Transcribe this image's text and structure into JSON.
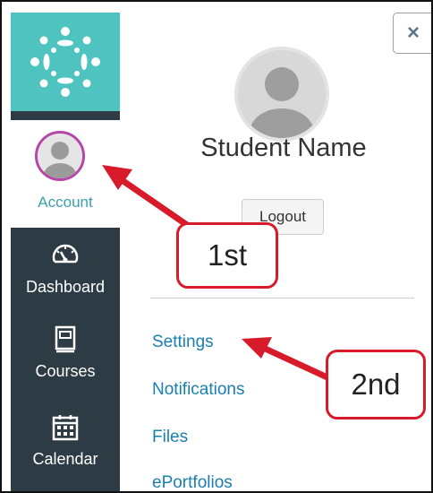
{
  "global_nav": {
    "logo": {
      "icon": "canvas-logo-icon",
      "color": "#4fc3c0"
    },
    "background_color": "#2d3b45",
    "items": [
      {
        "label": "Account",
        "icon": "avatar-icon",
        "active": true
      },
      {
        "label": "Dashboard",
        "icon": "dashboard-icon"
      },
      {
        "label": "Courses",
        "icon": "book-icon"
      },
      {
        "label": "Calendar",
        "icon": "calendar-icon"
      }
    ]
  },
  "tray": {
    "close_label": "×",
    "student_name": "Student Name",
    "logout_label": "Logout",
    "links": [
      {
        "label": "Settings"
      },
      {
        "label": "Notifications"
      },
      {
        "label": "Files"
      },
      {
        "label": "ePortfolios"
      }
    ],
    "link_color": "#1a7fb0"
  },
  "annotations": {
    "step1": "1st",
    "step2": "2nd",
    "color": "#d81b2a"
  }
}
